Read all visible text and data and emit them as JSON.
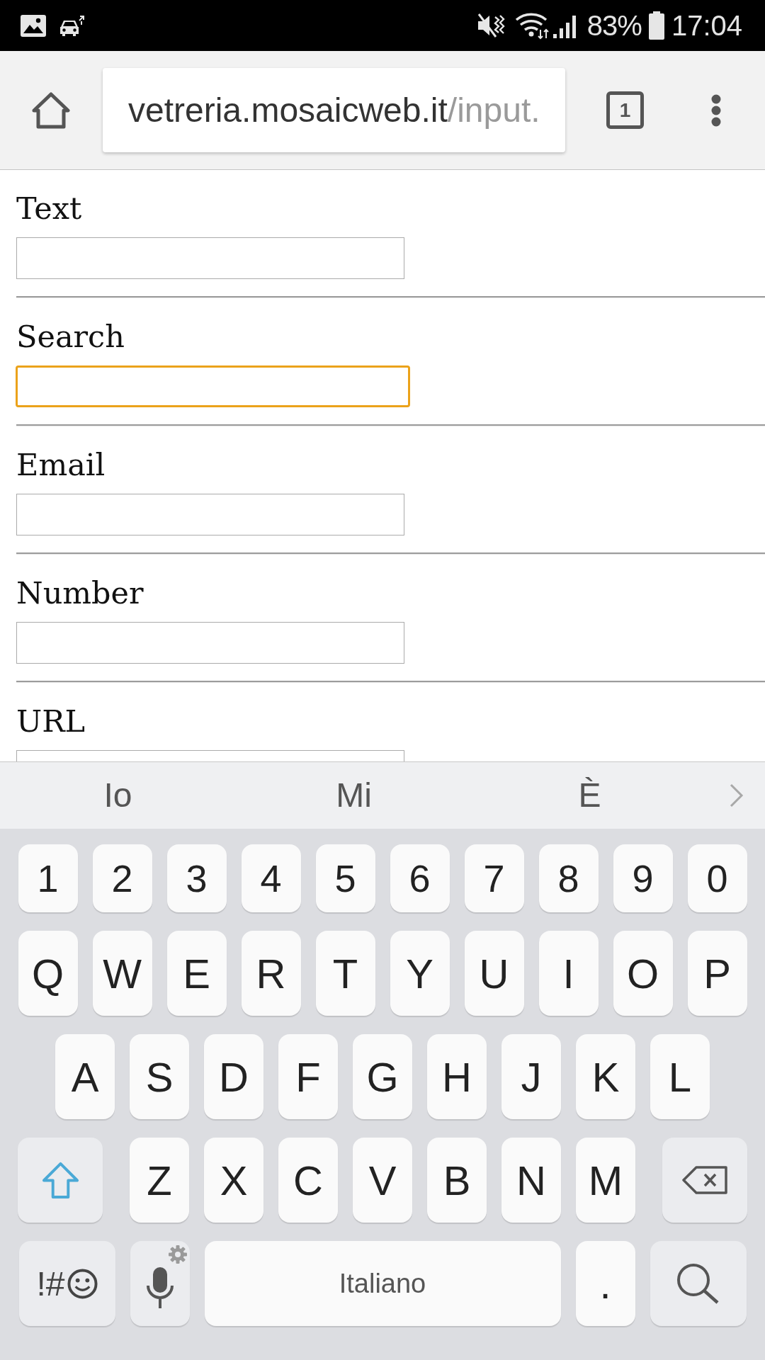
{
  "status_bar": {
    "battery": "83%",
    "time": "17:04"
  },
  "browser": {
    "url_domain": "vetreria.mosaicweb.it",
    "url_path": "/input.",
    "tab_count": "1"
  },
  "form": {
    "fields": [
      {
        "label": "Text",
        "focused": false
      },
      {
        "label": "Search",
        "focused": true
      },
      {
        "label": "Email",
        "focused": false
      },
      {
        "label": "Number",
        "focused": false
      },
      {
        "label": "URL",
        "focused": false
      }
    ]
  },
  "keyboard": {
    "suggestions": [
      "Io",
      "Mi",
      "È"
    ],
    "shift_on": true,
    "rows": [
      {
        "keys": [
          {
            "kind": "char",
            "label": "1"
          },
          {
            "kind": "char",
            "label": "2"
          },
          {
            "kind": "char",
            "label": "3"
          },
          {
            "kind": "char",
            "label": "4"
          },
          {
            "kind": "char",
            "label": "5"
          },
          {
            "kind": "char",
            "label": "6"
          },
          {
            "kind": "char",
            "label": "7"
          },
          {
            "kind": "char",
            "label": "8"
          },
          {
            "kind": "char",
            "label": "9"
          },
          {
            "kind": "char",
            "label": "0"
          }
        ]
      },
      {
        "keys": [
          {
            "kind": "char",
            "label": "Q"
          },
          {
            "kind": "char",
            "label": "W"
          },
          {
            "kind": "char",
            "label": "E"
          },
          {
            "kind": "char",
            "label": "R"
          },
          {
            "kind": "char",
            "label": "T"
          },
          {
            "kind": "char",
            "label": "Y"
          },
          {
            "kind": "char",
            "label": "U"
          },
          {
            "kind": "char",
            "label": "I"
          },
          {
            "kind": "char",
            "label": "O"
          },
          {
            "kind": "char",
            "label": "P"
          }
        ]
      },
      {
        "keys": [
          {
            "kind": "char",
            "label": "A"
          },
          {
            "kind": "char",
            "label": "S"
          },
          {
            "kind": "char",
            "label": "D"
          },
          {
            "kind": "char",
            "label": "F"
          },
          {
            "kind": "char",
            "label": "G"
          },
          {
            "kind": "char",
            "label": "H"
          },
          {
            "kind": "char",
            "label": "J"
          },
          {
            "kind": "char",
            "label": "K"
          },
          {
            "kind": "char",
            "label": "L"
          }
        ]
      },
      {
        "keys": [
          {
            "kind": "shift"
          },
          {
            "kind": "char",
            "label": "Z"
          },
          {
            "kind": "char",
            "label": "X"
          },
          {
            "kind": "char",
            "label": "C"
          },
          {
            "kind": "char",
            "label": "V"
          },
          {
            "kind": "char",
            "label": "B"
          },
          {
            "kind": "char",
            "label": "N"
          },
          {
            "kind": "char",
            "label": "M"
          },
          {
            "kind": "backspace"
          }
        ]
      },
      {
        "keys": [
          {
            "kind": "symbols",
            "label": "!#"
          },
          {
            "kind": "voice"
          },
          {
            "kind": "space",
            "label": "Italiano"
          },
          {
            "kind": "char",
            "label": "."
          },
          {
            "kind": "search"
          }
        ]
      }
    ]
  }
}
